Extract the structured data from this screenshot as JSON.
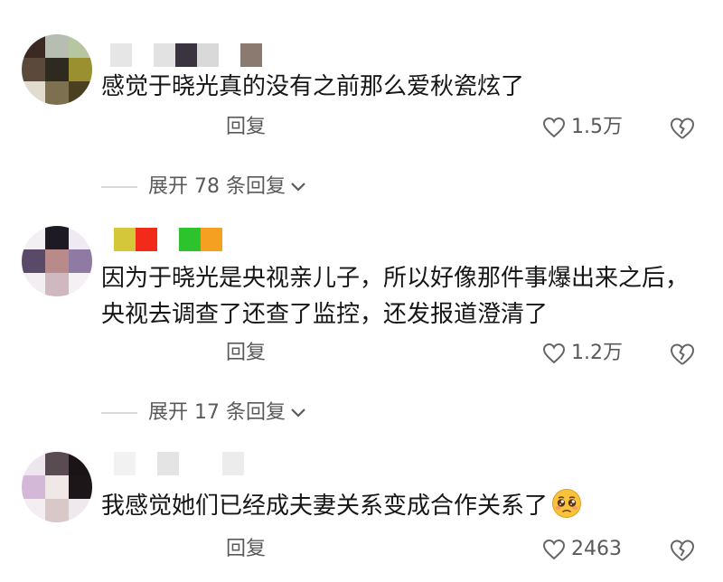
{
  "comments": [
    {
      "text": "感觉于晓光真的没有之前那么爱秋瓷炫了",
      "reply_label": "回复",
      "likes": "1.5万",
      "replies_label": "展开 78 条回复",
      "avatar_colors": [
        "#3a2a22",
        "#b8bdb2",
        "#b5c6a0",
        "#5b4a3c",
        "#2f2a20",
        "#9a9030",
        "#e2dbd0",
        "#7d7050",
        "#4a4020"
      ],
      "name_colors": [
        "#e6e6e6",
        "#ffffff",
        "#e2e2e2",
        "#3a3340",
        "#d9d9d9",
        "#ffffff",
        "#8a7a70"
      ]
    },
    {
      "text": "因为于晓光是央视亲儿子，所以好像那件事爆出来之后，央视去调查了还查了监控，还发报道澄清了",
      "reply_label": "回复",
      "likes": "1.2万",
      "replies_label": "展开 17 条回复",
      "avatar_colors": [
        "#f2f0f2",
        "#1e1a24",
        "#efeaf2",
        "#5a4a6a",
        "#b98a8a",
        "#8e7aa2",
        "#f3eef2",
        "#d0b8c0",
        "#f4f0f4"
      ],
      "name_colors": [
        "#d4c83a",
        "#f22a1a",
        "#ffffff",
        "#2cc32c",
        "#f5a020"
      ]
    },
    {
      "text": "我感觉她们已经成夫妻关系变成合作关系了",
      "reply_label": "回复",
      "likes": "2463",
      "avatar_colors": [
        "#ede6ee",
        "#5a4a52",
        "#1a1416",
        "#d3b8d8",
        "#f0e8e6",
        "#1c1618",
        "#f4eef2",
        "#d8c8c8",
        "#efe8ec"
      ],
      "name_colors": [
        "#f2f2f2",
        "#ffffff",
        "#e4e4e4",
        "#ffffff",
        "#ffffff",
        "#ececec"
      ]
    }
  ],
  "icons": {
    "like": "heart-outline-icon",
    "dislike": "broken-heart-icon",
    "expand": "chevron-down-icon",
    "emoji": "pleading-face-emoji"
  },
  "colors": {
    "text": "#161616",
    "muted": "#5a5a5a",
    "background": "#ffffff"
  }
}
